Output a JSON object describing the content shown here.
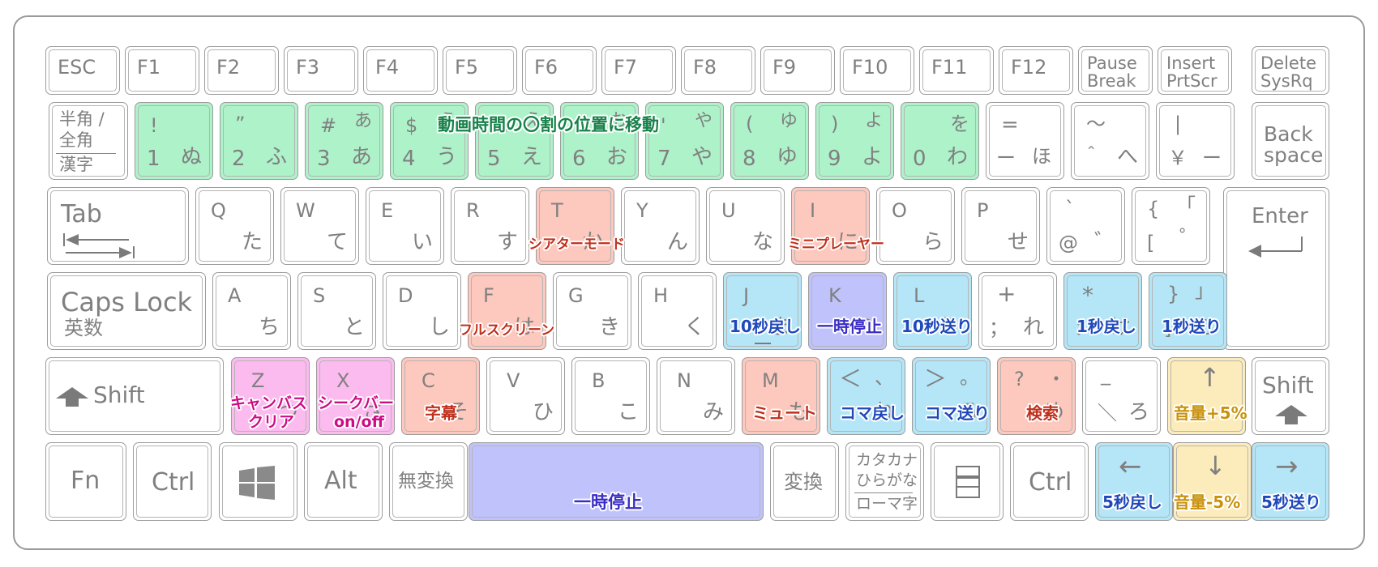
{
  "colors": {
    "green": "#adf2c9",
    "salmon": "#fdc8bd",
    "blue": "#b4e6f8",
    "purple": "#c0c3fb",
    "pink": "#fbbbee",
    "yellow": "#fdecbb"
  },
  "row_f": {
    "esc": "ESC",
    "f1": "F1",
    "f2": "F2",
    "f3": "F3",
    "f4": "F4",
    "f5": "F5",
    "f6": "F6",
    "f7": "F7",
    "f8": "F8",
    "f9": "F9",
    "f10": "F10",
    "f11": "F11",
    "f12": "F12",
    "pause": "Pause",
    "break": "Break",
    "insert": "Insert",
    "prtscr": "PrtScr",
    "delete": "Delete",
    "sysrq": "SysRq"
  },
  "row_num": {
    "hankaku": "半角 /",
    "zenkaku": "全角",
    "kanji": "漢字",
    "k1_top": "!",
    "k1_num": "1",
    "k1_kana": "ぬ",
    "k2_top": "”",
    "k2_num": "2",
    "k2_kana": "ふ",
    "k3_top": "#",
    "k3_topkana": "あ",
    "k3_num": "3",
    "k3_kana": "あ",
    "k4_top": "$",
    "k4_topkana": "う",
    "k4_num": "4",
    "k4_kana": "う",
    "k5_top": "%",
    "k5_topkana": "え",
    "k5_num": "5",
    "k5_kana": "え",
    "k6_top": "&",
    "k6_topkana": "お",
    "k6_num": "6",
    "k6_kana": "お",
    "k7_top": "'",
    "k7_topkana": "や",
    "k7_num": "7",
    "k7_kana": "や",
    "k8_top": "(",
    "k8_topkana": "ゆ",
    "k8_num": "8",
    "k8_kana": "ゆ",
    "k9_top": ")",
    "k9_topkana": "よ",
    "k9_num": "9",
    "k9_kana": "よ",
    "k0_topkana": "を",
    "k0_num": "0",
    "k0_kana": "わ",
    "minus_top": "=",
    "minus_sym": "ー",
    "minus_kana": "ほ",
    "caret_top": "～",
    "caret_sym": "＾",
    "caret_kana": "へ",
    "yen_top": "|",
    "yen_sym": "￥",
    "yen_kana": "ー",
    "back": "Back",
    "space": "space"
  },
  "row_q": {
    "tab": "Tab",
    "q": "Q",
    "q_kana": "た",
    "w": "W",
    "w_kana": "て",
    "e": "E",
    "e_kana": "い",
    "r": "R",
    "r_kana": "す",
    "t": "T",
    "t_kana": "か",
    "y": "Y",
    "y_kana": "ん",
    "u": "U",
    "u_kana": "な",
    "i": "I",
    "i_kana": "に",
    "o": "O",
    "o_kana": "ら",
    "p": "P",
    "p_kana": "せ",
    "at_top": "`",
    "at_sym": "@",
    "at_kana": "゛",
    "br_top": "{",
    "br_topkana": "「",
    "br_sym": "[",
    "br_kana": "゜",
    "enter": "Enter"
  },
  "row_a": {
    "caps": "Caps Lock",
    "eisu": "英数",
    "a": "A",
    "a_kana": "ち",
    "s": "S",
    "s_kana": "と",
    "d": "D",
    "d_kana": "し",
    "f": "F",
    "f_kana": "は",
    "g": "G",
    "g_kana": "き",
    "h": "H",
    "h_kana": "く",
    "j": "J",
    "j_kana": "ま",
    "k": "K",
    "k_kana": "の",
    "l": "L",
    "l_kana": "り",
    "semi_top": "+",
    "semi_sym": "；",
    "semi_kana": "れ",
    "colon_top": "*",
    "colon_sym": "：",
    "colon_kana": "け",
    "rb_top": "}",
    "rb_topkana": "」",
    "rb_sym": "]",
    "rb_kana": "む"
  },
  "row_z": {
    "shift": "Shift",
    "z": "Z",
    "z_kana": "つ",
    "x": "X",
    "x_kana": "さ",
    "c": "C",
    "c_kana": "そ",
    "v": "V",
    "v_kana": "ひ",
    "b": "B",
    "b_kana": "こ",
    "n": "N",
    "n_kana": "み",
    "m": "M",
    "m_kana": "も",
    "comma_top": "＜",
    "comma_topkana": "、",
    "comma_kana": "ね",
    "period_top": "＞",
    "period_topkana": "。",
    "period_kana": "る",
    "slash_top": "?",
    "slash_topkana": "・",
    "slash_kana": "め",
    "bs_top": "_",
    "bs_sym": "＼",
    "bs_kana": "ろ",
    "up": "↑",
    "rshift": "Shift"
  },
  "row_bottom": {
    "fn": "Fn",
    "ctrl": "Ctrl",
    "alt": "Alt",
    "muhenkan": "無変換",
    "henkan": "変換",
    "katakana": "カタカナ",
    "hiragana": "ひらがな",
    "romaji": "ローマ字",
    "rctrl": "Ctrl",
    "left": "←",
    "down": "↓",
    "right": "→"
  },
  "shortcuts": {
    "seek_percent": "動画時間の〇割の位置に移動",
    "theater": "シアターモード",
    "miniplayer": "ミニプレーヤー",
    "fullscreen": "フルスクリーン",
    "back10": "10秒戻し",
    "pause_k": "一時停止",
    "fwd10": "10秒送り",
    "back1": "1秒戻し",
    "fwd1": "1秒送り",
    "canvas_clear_1": "キャンバス",
    "canvas_clear_2": "クリア",
    "seekbar_1": "シークバー",
    "seekbar_2": "on/off",
    "captions": "字幕",
    "mute": "ミュート",
    "frame_back": "コマ戻し",
    "frame_fwd": "コマ送り",
    "search": "検索",
    "vol_up": "音量+5%",
    "pause_space": "一時停止",
    "back5": "5秒戻し",
    "vol_down": "音量-5%",
    "fwd5": "5秒送り"
  }
}
